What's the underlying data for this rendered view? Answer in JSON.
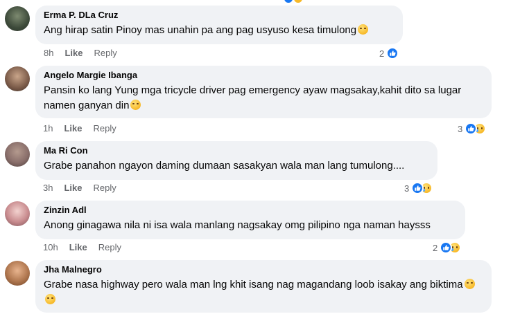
{
  "comments": [
    {
      "author": "Erma P. DLa Cruz",
      "text": "Ang hirap satin Pinoy mas unahin pa ang pag usyuso kesa timulong",
      "emojis": [
        "sad-face"
      ],
      "time": "8h",
      "like_label": "Like",
      "reply_label": "Reply",
      "reaction_count": "2",
      "reactions": [
        "like"
      ],
      "avatar_color": "#3d4a3a"
    },
    {
      "author": "Angelo Margie Ibanga",
      "text": "Pansin ko lang Yung mga tricycle driver pag emergency ayaw magsakay,kahit dito sa lugar namen ganyan din",
      "emojis": [
        "smirk-face"
      ],
      "time": "1h",
      "like_label": "Like",
      "reply_label": "Reply",
      "reaction_count": "3",
      "reactions": [
        "like",
        "sad"
      ],
      "avatar_color": "#7a5a48"
    },
    {
      "author": "Ma Ri Con",
      "text": "Grabe panahon ngayon daming dumaan sasakyan wala man lang tumulong....",
      "emojis": [],
      "time": "3h",
      "like_label": "Like",
      "reply_label": "Reply",
      "reaction_count": "3",
      "reactions": [
        "like",
        "sad"
      ],
      "avatar_color": "#8a6f6b"
    },
    {
      "author": "Zinzin Adl",
      "text": "Anong ginagawa nila ni isa wala manlang nagsakay omg pilipino nga naman haysss",
      "emojis": [],
      "time": "10h",
      "like_label": "Like",
      "reply_label": "Reply",
      "reaction_count": "2",
      "reactions": [
        "like",
        "sad"
      ],
      "avatar_color": "#c98c8f"
    },
    {
      "author": "Jha Malnegro",
      "text": "Grabe nasa highway pero wala man lng khit isang nag magandang loob isakay ang biktima",
      "emojis": [
        "relieved-face",
        "unamused-face"
      ],
      "time": "",
      "like_label": "",
      "reply_label": "",
      "reaction_count": "",
      "reactions": [],
      "avatar_color": "#b0774f"
    }
  ],
  "colors": {
    "bubble": "#f0f2f5",
    "meta_text": "#65676b",
    "like_blue": "#1877f2",
    "emoji_yellow": "#f7b928"
  }
}
